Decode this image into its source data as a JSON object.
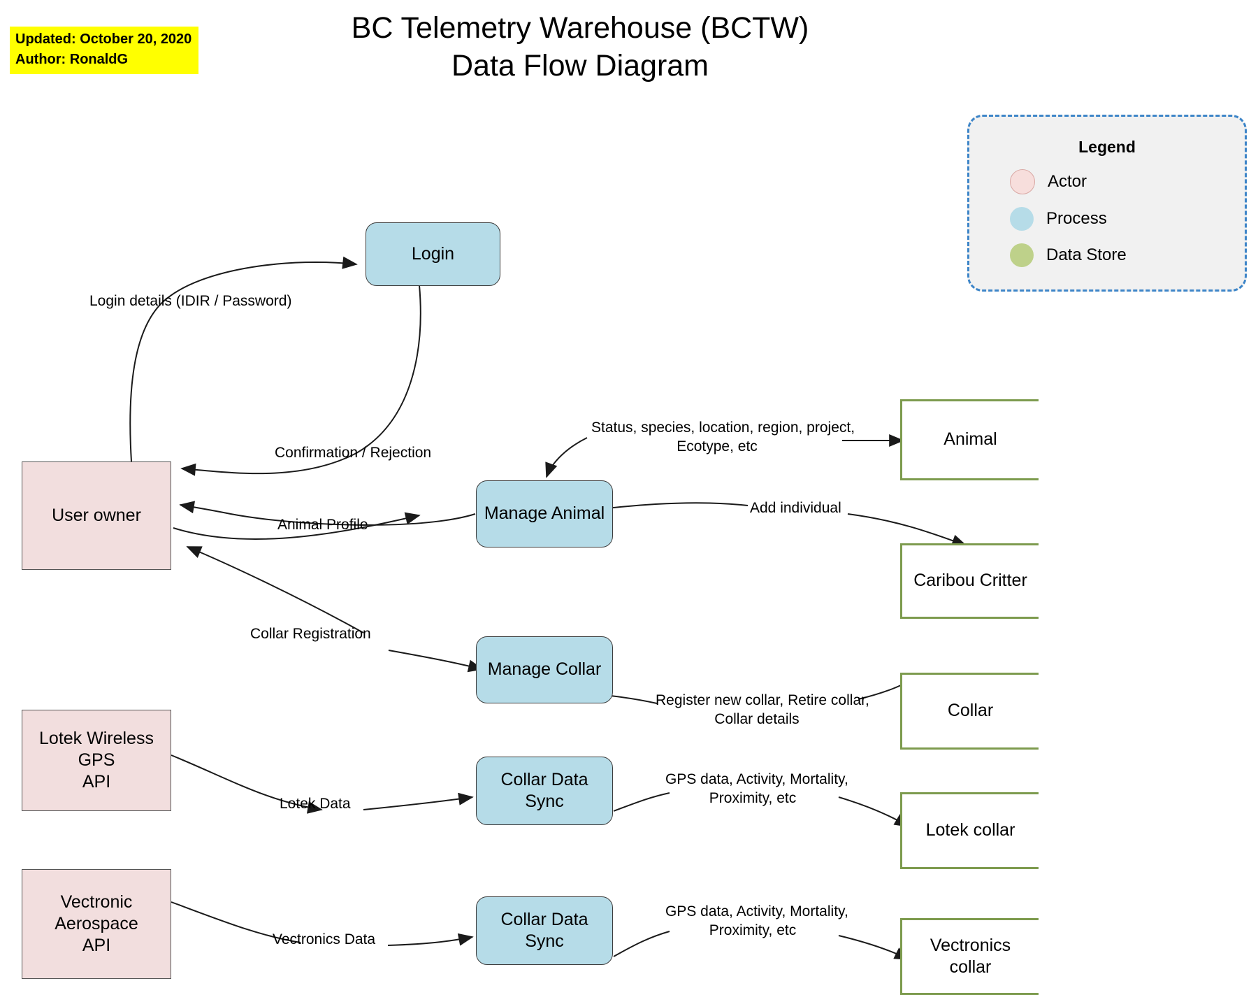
{
  "note": {
    "updated": "Updated: October 20, 2020",
    "author": "Author: RonaldG",
    "highlight_color": "#ffff00"
  },
  "title": {
    "line1": "BC Telemetry Warehouse (BCTW)",
    "line2": "Data Flow Diagram"
  },
  "legend": {
    "title": "Legend",
    "items": [
      {
        "label": "Actor",
        "color": "#f7dedc"
      },
      {
        "label": "Process",
        "color": "#b6dce8"
      },
      {
        "label": "Data Store",
        "color": "#bed18a"
      }
    ],
    "border_color": "#3d85c8",
    "background": "#f1f1f1"
  },
  "colors": {
    "actor_fill": "#f2dede",
    "actor_stroke": "#555555",
    "process_fill": "#b6dce8",
    "process_stroke": "#3d3d3d",
    "datastore_stroke": "#7d9b4e",
    "arrow": "#1a1a1a"
  },
  "nodes": [
    {
      "id": "login",
      "type": "process",
      "label": "Login"
    },
    {
      "id": "user-owner",
      "type": "actor",
      "label": "User owner"
    },
    {
      "id": "manage-animal",
      "type": "process",
      "label": "Manage Animal"
    },
    {
      "id": "manage-collar",
      "type": "process",
      "label": "Manage Collar"
    },
    {
      "id": "lotek-api",
      "type": "actor",
      "label": "Lotek Wireless GPS API"
    },
    {
      "id": "vectronic-api",
      "type": "actor",
      "label": "Vectronic Aerospace API"
    },
    {
      "id": "collar-sync-lotek",
      "type": "process",
      "label": "Collar Data Sync"
    },
    {
      "id": "collar-sync-vect",
      "type": "process",
      "label": "Collar Data Sync"
    },
    {
      "id": "ds-animal",
      "type": "datastore",
      "label": "Animal"
    },
    {
      "id": "ds-caribou",
      "type": "datastore",
      "label": "Caribou Critter"
    },
    {
      "id": "ds-collar",
      "type": "datastore",
      "label": "Collar"
    },
    {
      "id": "ds-lotek-collar",
      "type": "datastore",
      "label": "Lotek collar"
    },
    {
      "id": "ds-vect-collar",
      "type": "datastore",
      "label": "Vectronics collar"
    }
  ],
  "node_labels": {
    "login": "Login",
    "user_owner": "User owner",
    "manage_animal": "Manage Animal",
    "manage_collar": "Manage Collar",
    "lotek_api": "Lotek Wireless GPS\nAPI",
    "vectronic_api": "Vectronic\nAerospace\nAPI",
    "collar_data_sync_lotek": "Collar Data\nSync",
    "collar_data_sync_vect": "Collar Data\nSync",
    "ds_animal": "Animal",
    "ds_caribou": "Caribou Critter",
    "ds_collar": "Collar",
    "ds_lotek_collar": "Lotek collar",
    "ds_vect_collar": "Vectronics\ncollar"
  },
  "edge_labels": {
    "login_details": "Login details (IDIR / Password)",
    "confirmation_rejection": "Confirmation / Rejection",
    "animal_profile": "Animal Profile",
    "animal_attributes": "Status, species, location, region, project,\nEcotype, etc",
    "add_individual": "Add individual",
    "collar_registration": "Collar Registration",
    "collar_actions": "Register new collar, Retire collar,\nCollar details",
    "lotek_data": "Lotek Data",
    "vectronics_data": "Vectronics Data",
    "gps_data_lotek": "GPS data, Activity, Mortality,\nProximity, etc",
    "gps_data_vect": "GPS data, Activity, Mortality,\nProximity, etc"
  }
}
